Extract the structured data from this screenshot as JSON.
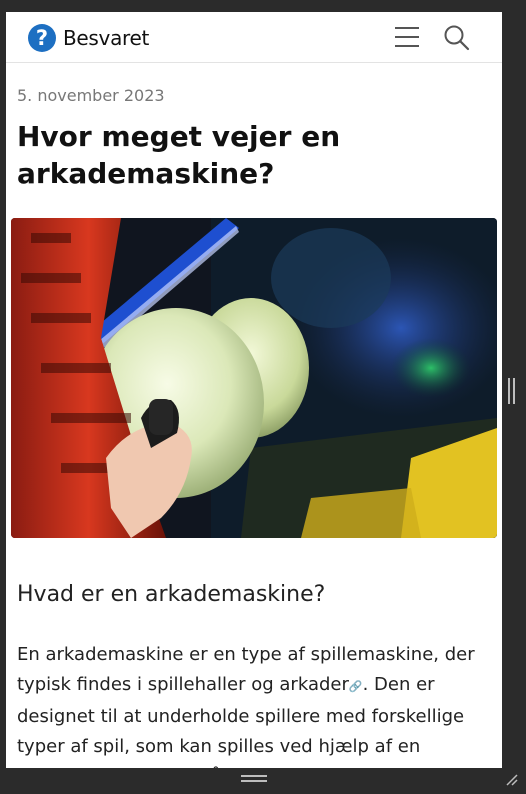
{
  "header": {
    "logo_symbol": "?",
    "site_name": "Besvaret",
    "menu_icon": "hamburger-menu-icon",
    "search_icon": "search-icon",
    "brand_color": "#1d6fc2"
  },
  "article": {
    "date": "5. november 2023",
    "title": "Hvor meget vejer en arkademaskine?",
    "image": "arcade-joystick-photo",
    "section_heading": "Hvad er en arkademaskine?",
    "body_before_link": "En arkademaskine er en type af spillemaskine, der typisk findes i spillehaller og ",
    "body_link_text": "arkader",
    "body_after_link": ". Den er designet til at underholde spillere med forskellige typer af spil, som kan spilles ved hjælp af en joystick og knapper på maskinen. De fleste arkademaskiner"
  }
}
